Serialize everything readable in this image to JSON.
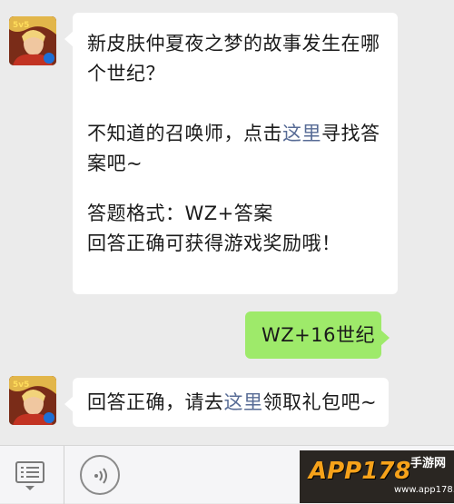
{
  "messages": [
    {
      "sender": "official-account",
      "lines": [
        "新皮肤仲夏夜之梦的故事发生在哪",
        "个世纪？"
      ]
    },
    {
      "sender": "official-account",
      "lines_before": "不知道的召唤师，点击",
      "link_text": "这里",
      "lines_after": "寻找答",
      "line2": "案吧~",
      "format_line": "答题格式：WZ+答案",
      "reward_line": "回答正确可获得游戏奖励哦！"
    },
    {
      "sender": "user",
      "text": "WZ+16世纪"
    },
    {
      "sender": "official-account",
      "before": "回答正确，请去",
      "link_text": "这里",
      "after": "领取礼包吧~"
    }
  ],
  "input_bar": {
    "menu_icon": "list-menu-icon",
    "voice_icon": "voice-wave-icon"
  },
  "watermark": {
    "main": "APP178",
    "sub1": "手游",
    "sub2": "网",
    "url": "www.app178.com"
  },
  "colors": {
    "chat_bg": "#ebebeb",
    "incoming_bubble": "#ffffff",
    "outgoing_bubble": "#9eea6a",
    "link": "#576b95"
  }
}
